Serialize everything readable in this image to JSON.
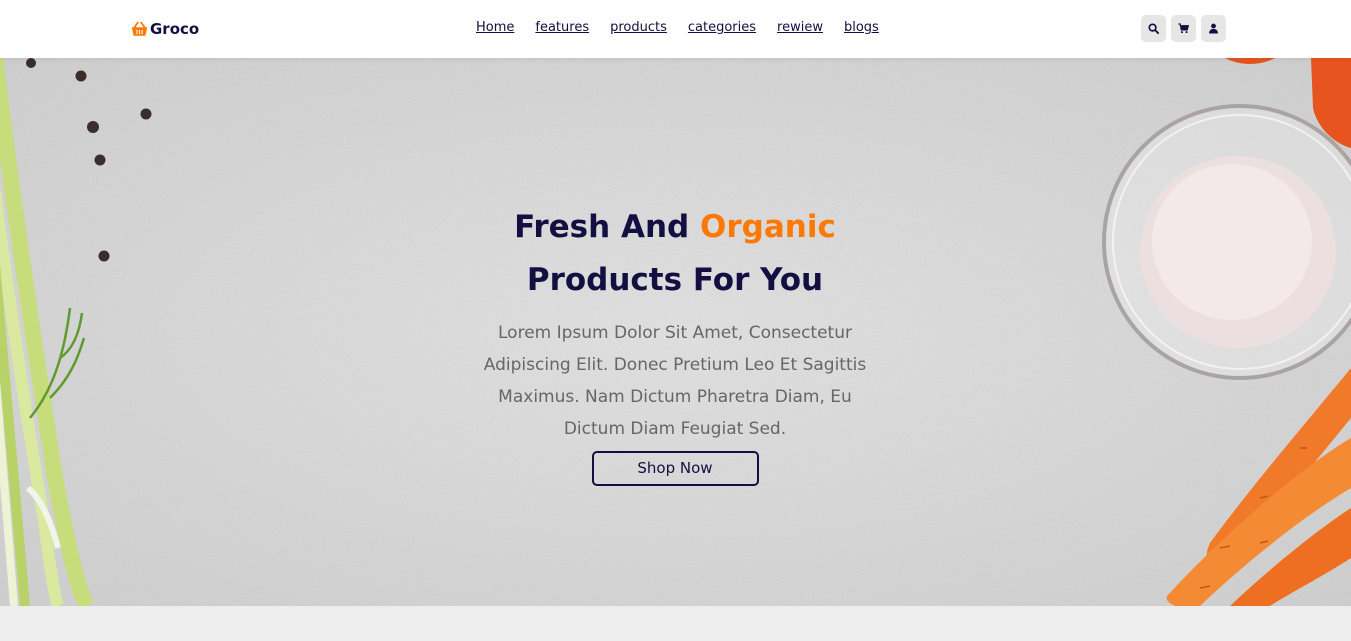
{
  "header": {
    "logo_text": "Groco",
    "logo_icon": "basket-icon",
    "nav": [
      {
        "label": "Home"
      },
      {
        "label": "features"
      },
      {
        "label": "products"
      },
      {
        "label": "categories"
      },
      {
        "label": "rewiew"
      },
      {
        "label": "blogs"
      }
    ],
    "icons": [
      "search-icon",
      "cart-icon",
      "user-icon"
    ]
  },
  "hero": {
    "title_part1": "Fresh And",
    "title_accent": "Organic",
    "title_part2": "Products For You",
    "description": "Lorem Ipsum Dolor Sit Amet, Consectetur Adipiscing Elit. Donec Pretium Leo Et Sagittis Maximus. Nam Dictum Pharetra Diam, Eu Dictum Diam Feugiat Sed.",
    "button_label": "Shop Now"
  },
  "colors": {
    "accent": "#ff7800",
    "dark": "#130f40",
    "background": "#d8d8d8"
  }
}
